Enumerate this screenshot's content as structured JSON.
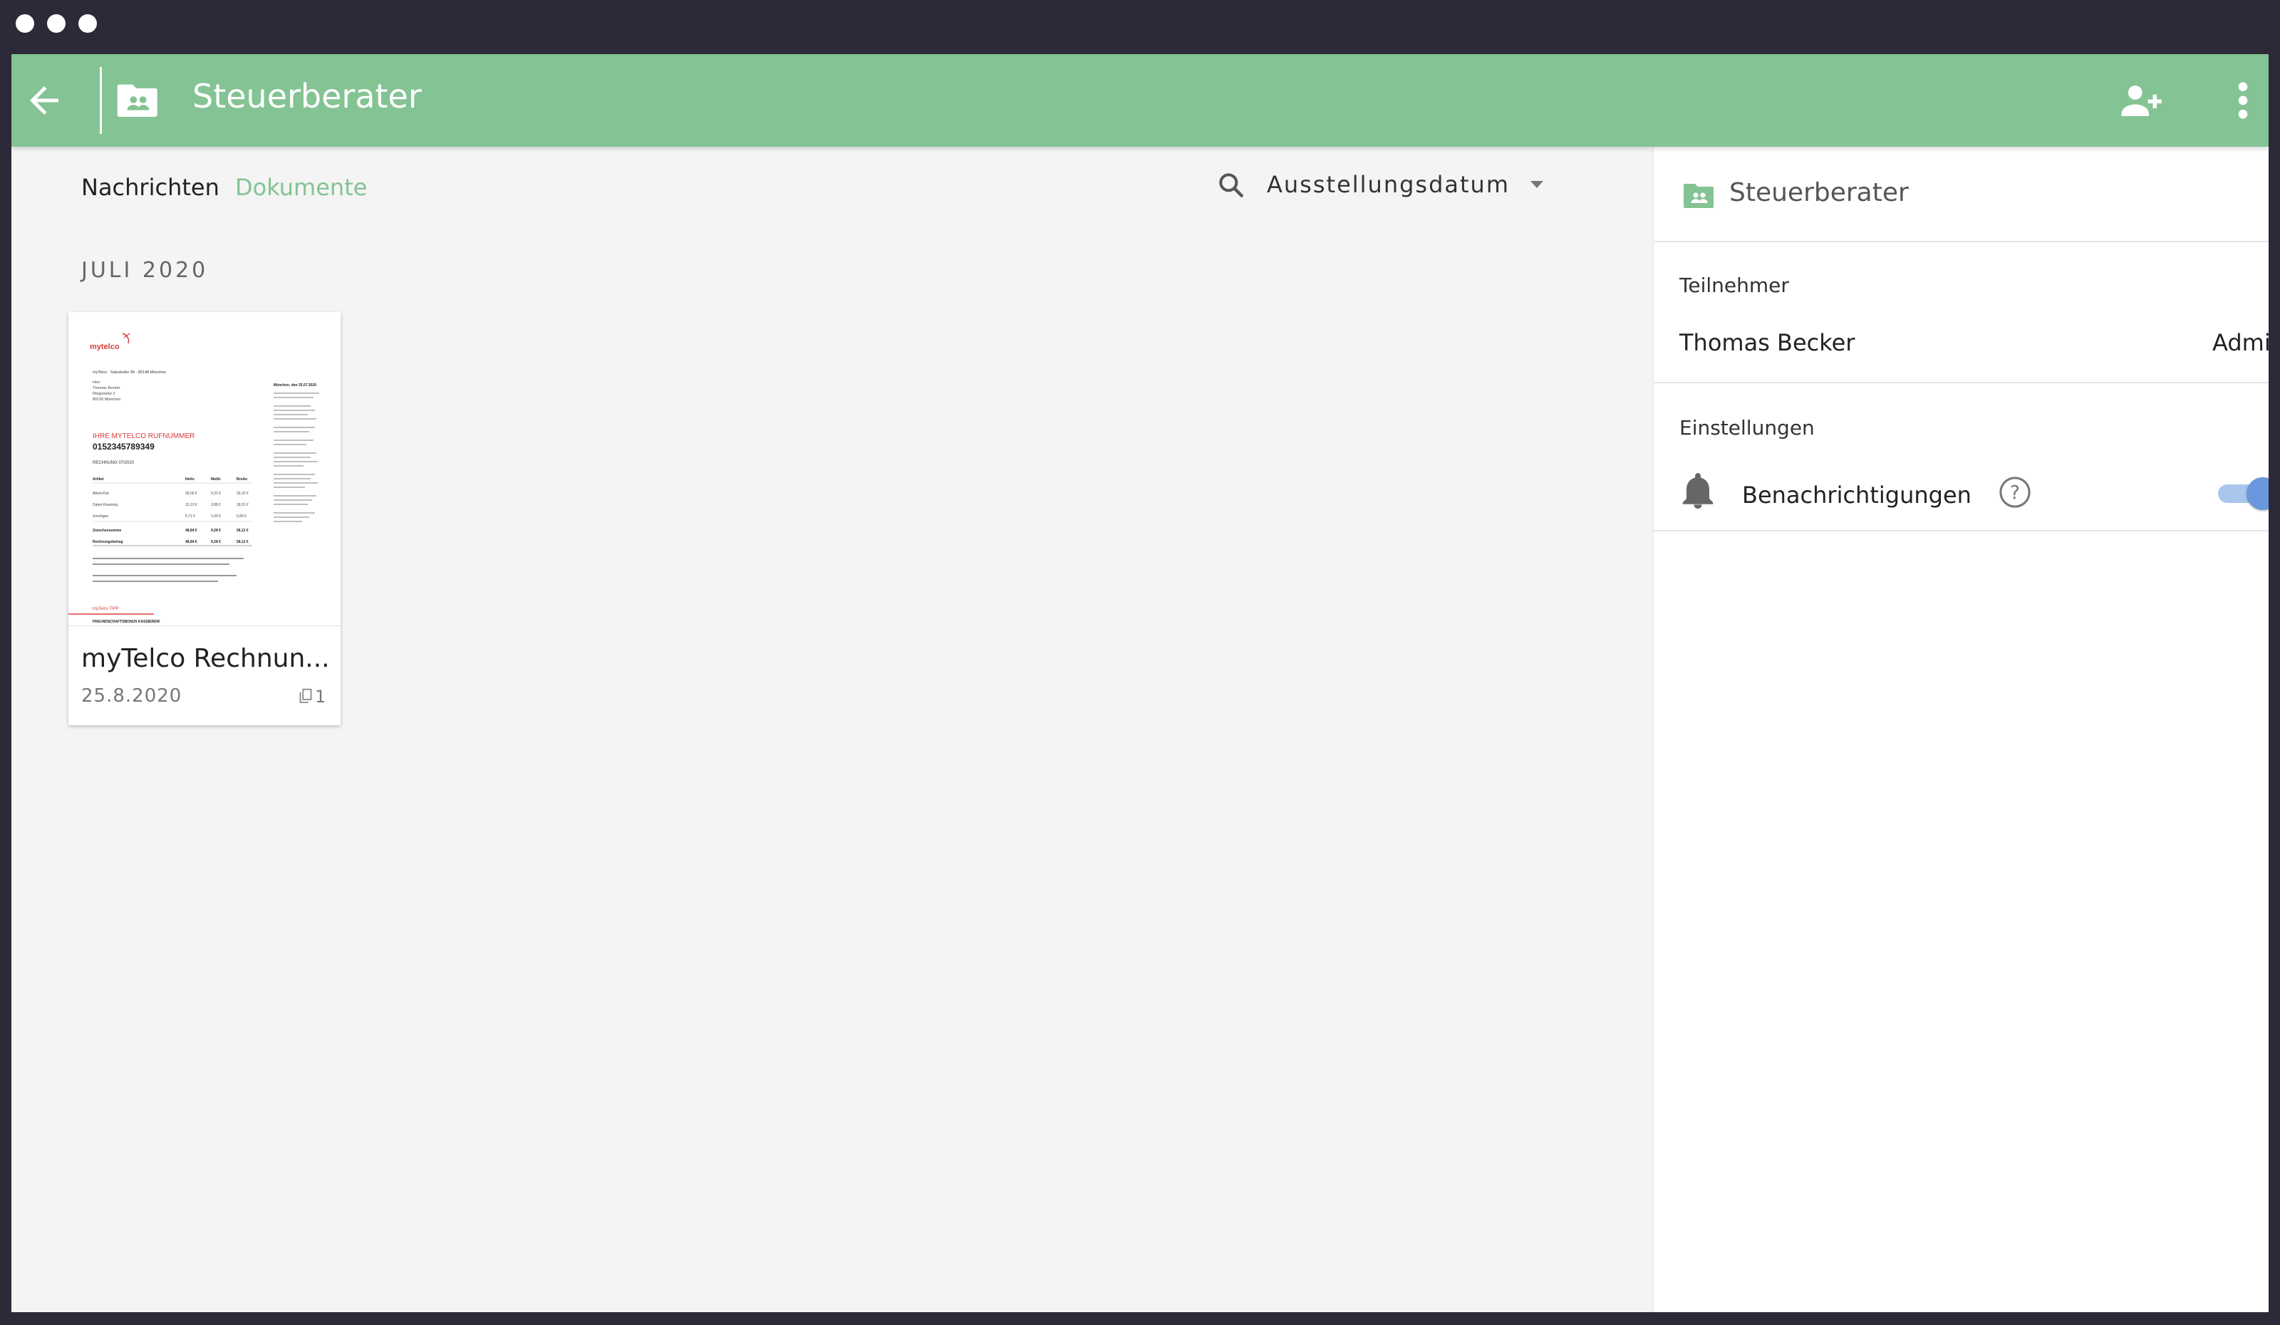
{
  "header": {
    "title": "Steuerberater",
    "icons": [
      "arrow-left-icon",
      "folder-shared-icon",
      "person-add-icon",
      "more-vert-icon"
    ],
    "accent_color": "#84c393"
  },
  "tabs": [
    {
      "label": "Nachrichten",
      "active": false
    },
    {
      "label": "Dokumente",
      "active": true
    }
  ],
  "sort": {
    "label": "Ausstellungsdatum"
  },
  "groups": [
    {
      "month": "JULI 2020",
      "documents": [
        {
          "title": "myTelco Rechnun...",
          "date": "25.8.2020",
          "page_count": "1",
          "preview": {
            "logo": "mytelco",
            "sender_line": "myTelco · Salzstraße 99 · 80148 München",
            "address": [
              "Herr",
              "Thomas Becker",
              "Ringstraße 2",
              "80135 München"
            ],
            "heading": "IHRE MYTELCO RUFNUMMER",
            "number": "0152345789349",
            "invoice": "RECHNUNG 07/2020",
            "table_headers": [
              "Artikel",
              "Netto",
              "MwSt.",
              "Brutto"
            ],
            "rows": [
              [
                "Allnet-Flat",
                "28,00 €",
                "5,32 €",
                "33,32 €"
              ],
              [
                "Daten-Roaming",
                "15,13 €",
                "2,88 €",
                "18,01 €"
              ],
              [
                "Sonstiges",
                "5,71 €",
                "1,09 €",
                "6,80 €"
              ],
              [
                "Zwischensumme",
                "48,84 €",
                "9,28 €",
                "58,12 €"
              ],
              [
                "Rechnungsbetrag",
                "48,84 €",
                "9,28 €",
                "58,12 €"
              ]
            ],
            "right_date": "München, den 25.07.2020",
            "tip": "myTelco TIPP",
            "tip_text": "FREUNDSCHAFTSBONUS KASSIEREN!"
          }
        }
      ]
    }
  ],
  "sidebar": {
    "title": "Steuerberater",
    "participants_label": "Teilnehmer",
    "participants": [
      {
        "name": "Thomas Becker",
        "role": "Admin"
      }
    ],
    "settings_label": "Einstellungen",
    "settings": [
      {
        "label": "Benachrichtigungen",
        "enabled": true
      }
    ],
    "toggle_color": "#6b98dd"
  }
}
